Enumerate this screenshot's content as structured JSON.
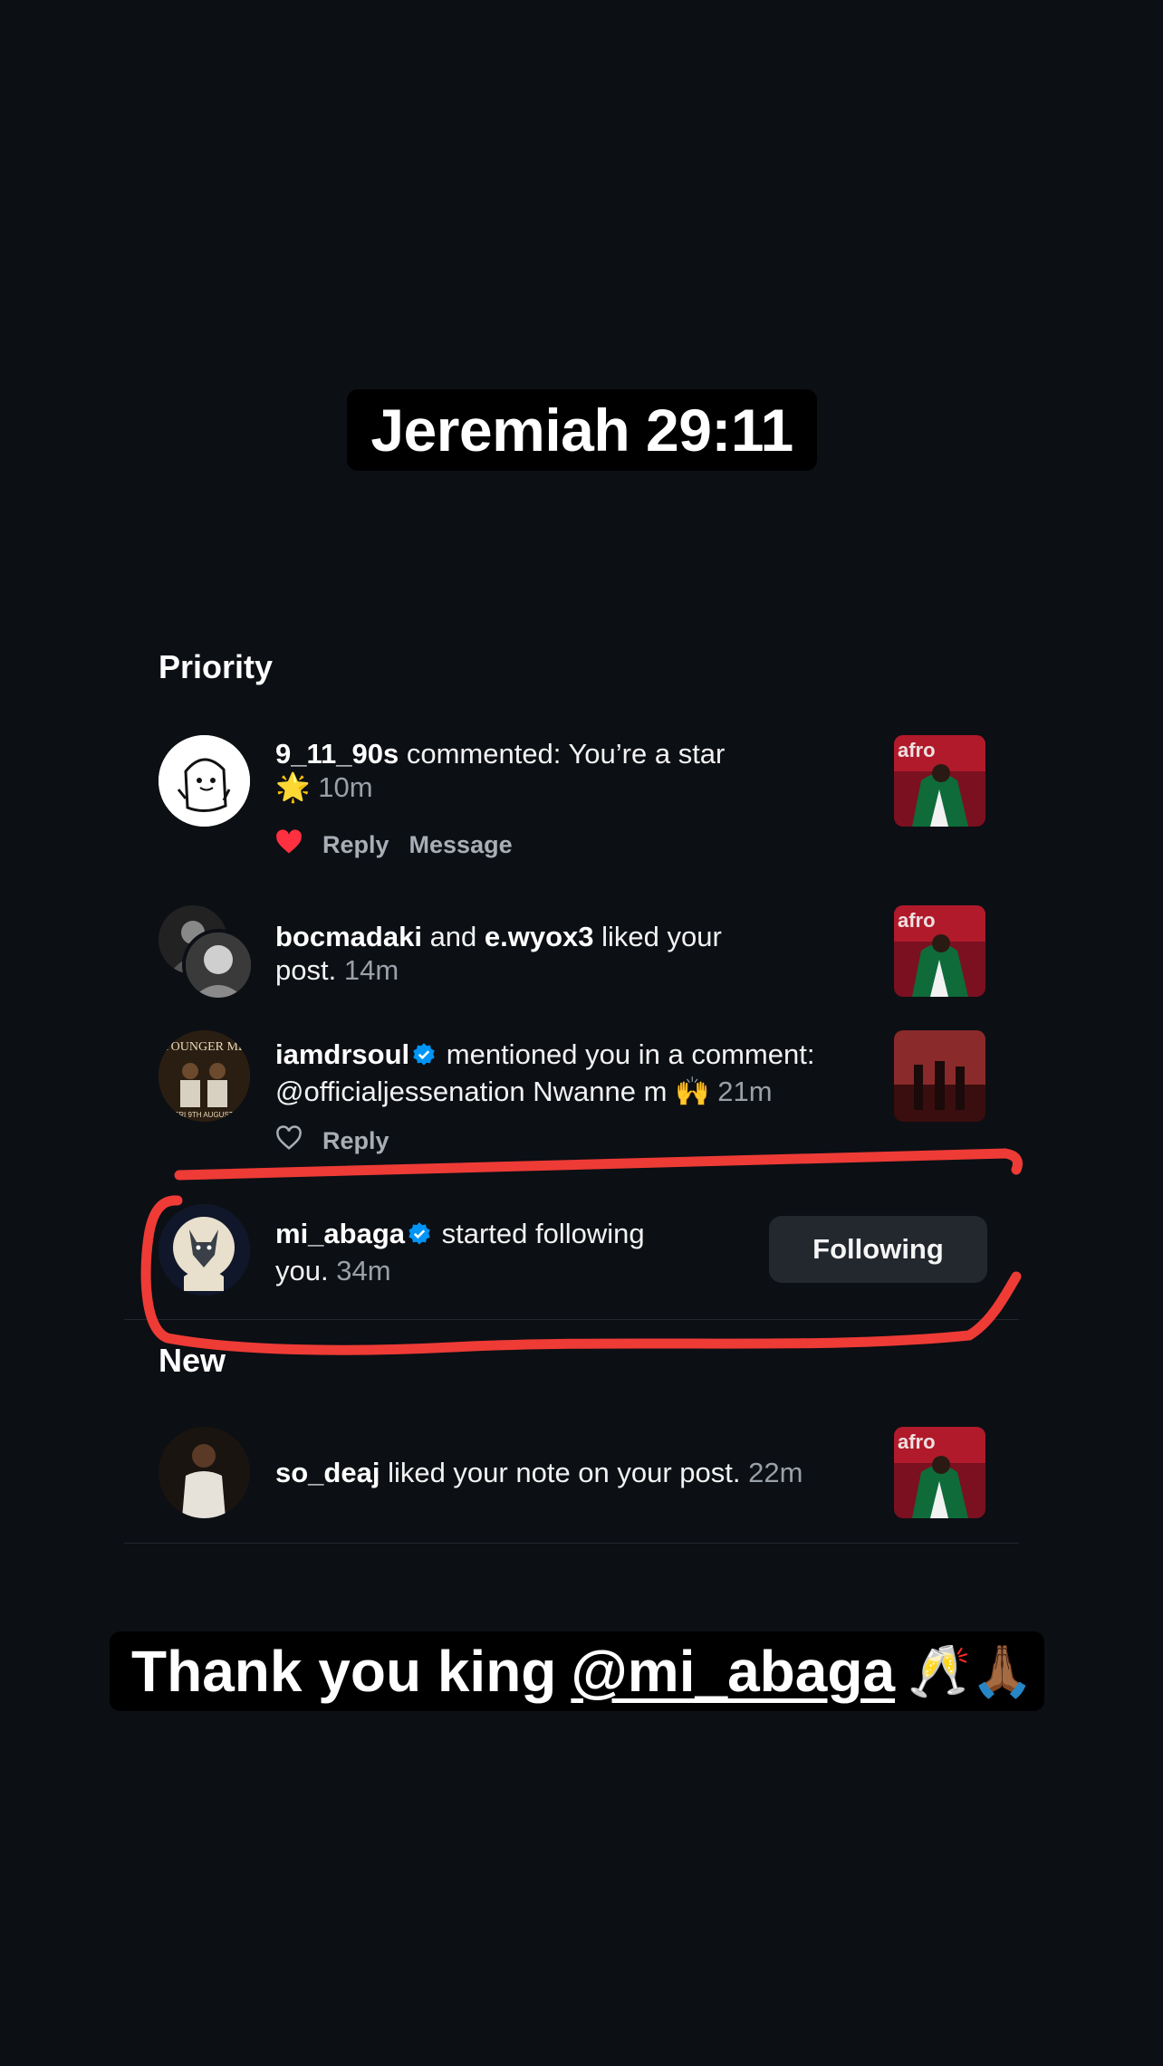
{
  "captions": {
    "top": "Jeremiah 29:11",
    "bottom_text": "Thank you king",
    "bottom_mention": "@mi_abaga",
    "bottom_emoji": "🥂🙏🏾"
  },
  "sections": {
    "priority": "Priority",
    "new": "New"
  },
  "notifications": [
    {
      "username": "9_11_90s",
      "text": " commented: You’re a star",
      "emoji": "🌟",
      "time": "10m",
      "actions": {
        "reply": "Reply",
        "message": "Message"
      }
    },
    {
      "username": "bocmadaki",
      "and": " and ",
      "username2": "e.wyox3",
      "text": " liked your",
      "text2": "post.",
      "time": "14m"
    },
    {
      "username": "iamdrsoul",
      "text": " mentioned you in a comment:",
      "text2": "@officialjessenation Nwanne m 🙌",
      "time": "21m",
      "actions": {
        "reply": "Reply"
      }
    },
    {
      "username": "mi_abaga",
      "text": " started following",
      "text2": "you.",
      "time": "34m",
      "button": "Following"
    },
    {
      "username": "so_deaj",
      "text": " liked your note on your post.",
      "time": "22m"
    }
  ],
  "colors": {
    "background": "#0c0f14",
    "like_red": "#ff3040",
    "verified_blue": "#0095f6",
    "annotation_red": "#ee3b36"
  }
}
